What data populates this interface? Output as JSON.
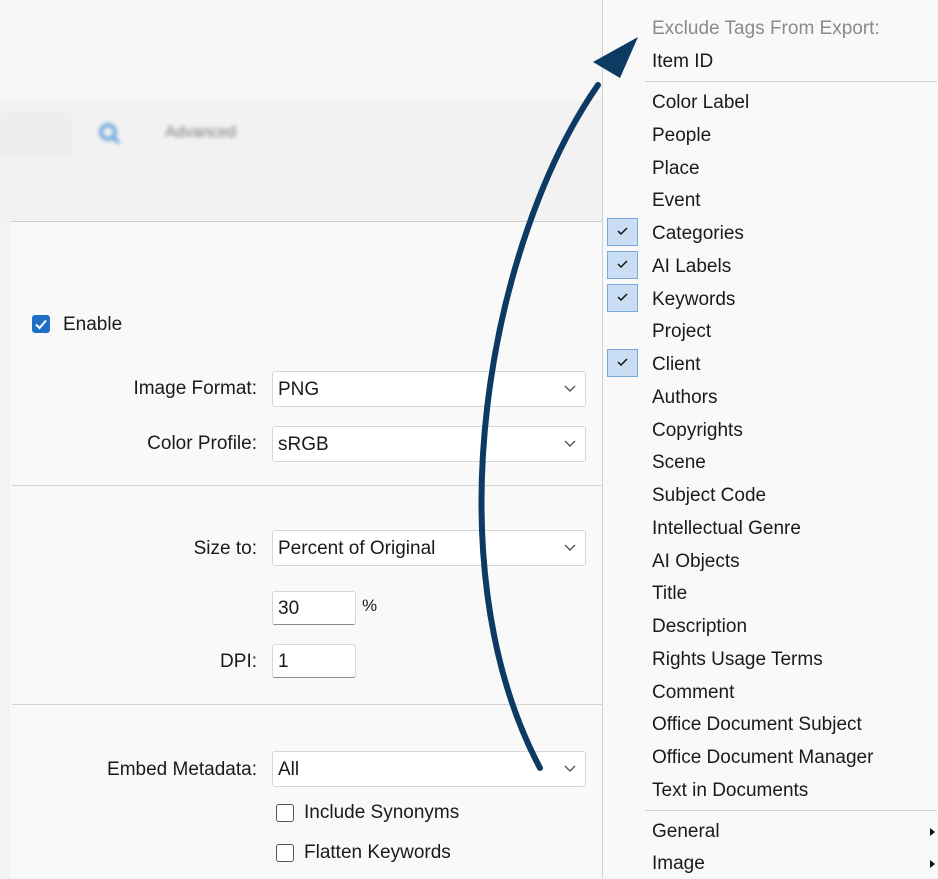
{
  "toolbar": {
    "advanced_label": "Advanced"
  },
  "settings": {
    "enable_label": "Enable",
    "image_format": {
      "label": "Image Format:",
      "value": "PNG"
    },
    "color_profile": {
      "label": "Color Profile:",
      "value": "sRGB"
    },
    "size_to": {
      "label": "Size to:",
      "value": "Percent of Original"
    },
    "percent": {
      "value": "30",
      "unit": "%"
    },
    "dpi": {
      "label": "DPI:",
      "value": "1"
    },
    "embed_metadata": {
      "label": "Embed Metadata:",
      "value": "All"
    },
    "include_synonyms_label": "Include Synonyms",
    "flatten_keywords_label": "Flatten Keywords"
  },
  "menu": {
    "header": "Exclude Tags From Export:",
    "items": [
      {
        "label": "Item ID",
        "checked": false
      },
      {
        "label": "Color Label",
        "checked": false
      },
      {
        "label": "People",
        "checked": false
      },
      {
        "label": "Place",
        "checked": false
      },
      {
        "label": "Event",
        "checked": false
      },
      {
        "label": "Categories",
        "checked": true
      },
      {
        "label": "AI Labels",
        "checked": true
      },
      {
        "label": "Keywords",
        "checked": true
      },
      {
        "label": "Project",
        "checked": false
      },
      {
        "label": "Client",
        "checked": true
      },
      {
        "label": "Authors",
        "checked": false
      },
      {
        "label": "Copyrights",
        "checked": false
      },
      {
        "label": "Scene",
        "checked": false
      },
      {
        "label": "Subject Code",
        "checked": false
      },
      {
        "label": "Intellectual Genre",
        "checked": false
      },
      {
        "label": "AI Objects",
        "checked": false
      },
      {
        "label": "Title",
        "checked": false
      },
      {
        "label": "Description",
        "checked": false
      },
      {
        "label": "Rights Usage Terms",
        "checked": false
      },
      {
        "label": "Comment",
        "checked": false
      },
      {
        "label": "Office Document Subject",
        "checked": false
      },
      {
        "label": "Office Document Manager",
        "checked": false
      },
      {
        "label": "Text in Documents",
        "checked": false
      },
      {
        "label": "General",
        "checked": false,
        "submenu": true
      },
      {
        "label": "Image",
        "checked": false,
        "submenu": true
      }
    ]
  },
  "colors": {
    "accent": "#1f6fc5",
    "arrow": "#0d3a63",
    "check_bg": "#c9def5"
  }
}
